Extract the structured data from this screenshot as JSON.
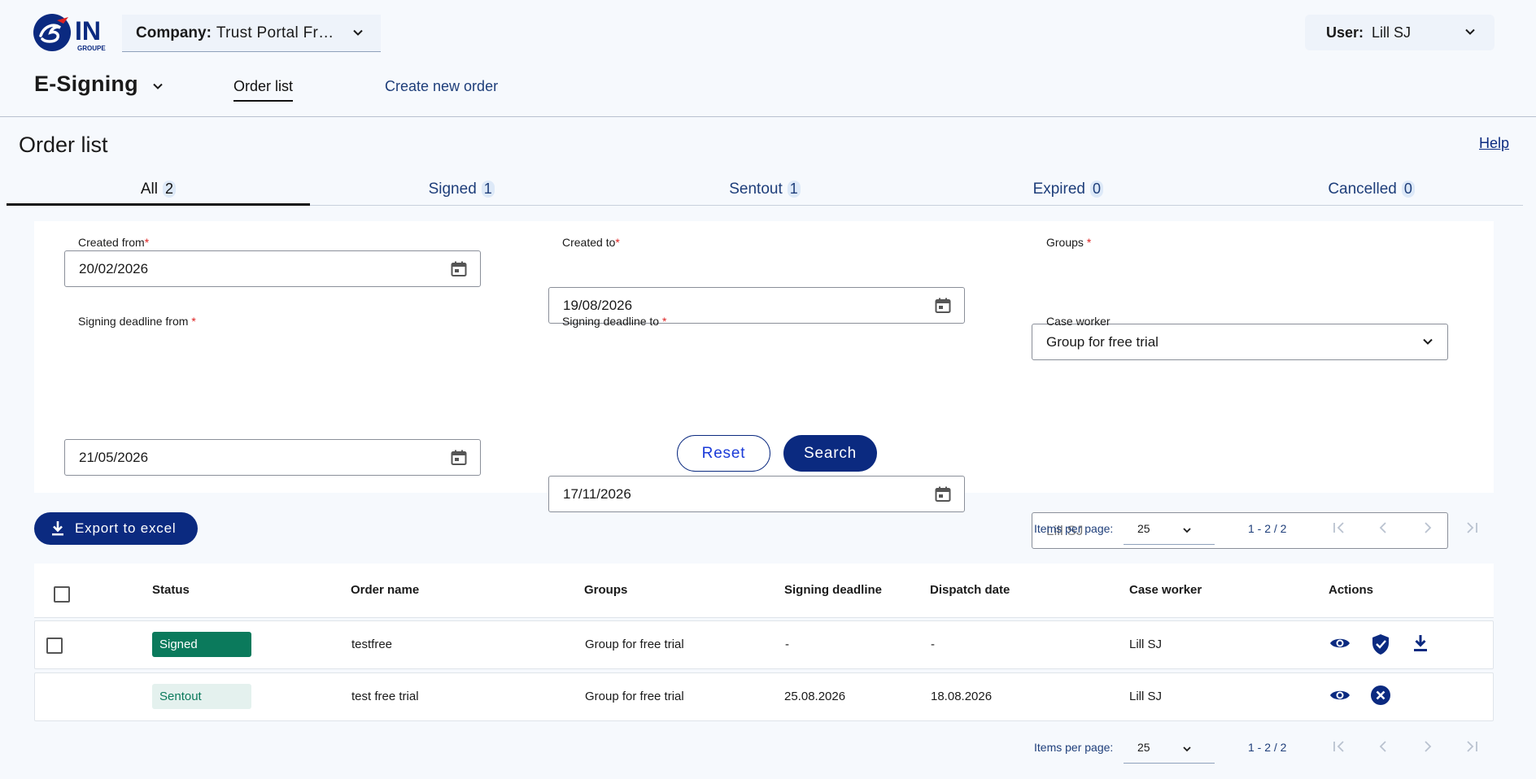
{
  "header": {
    "logo_text": "IN",
    "logo_subtext": "GROUPE",
    "company_label": "Company:",
    "company_value": "Trust Portal Fre...",
    "user_label": "User:",
    "user_value": "Lill SJ"
  },
  "app": {
    "name": "E-Signing",
    "nav_order_list": "Order list",
    "nav_create_order": "Create new order"
  },
  "page": {
    "title": "Order list",
    "help": "Help"
  },
  "tabs": [
    {
      "label": "All",
      "count": "2"
    },
    {
      "label": "Signed",
      "count": "1"
    },
    {
      "label": "Sentout",
      "count": "1"
    },
    {
      "label": "Expired",
      "count": "0"
    },
    {
      "label": "Cancelled",
      "count": "0"
    }
  ],
  "filters": {
    "created_from": {
      "label": "Created from",
      "value": "20/02/2026"
    },
    "created_to": {
      "label": "Created to",
      "value": "19/08/2026"
    },
    "groups": {
      "label": "Groups",
      "value": "Group for free trial"
    },
    "deadline_from": {
      "label": "Signing deadline from",
      "value": "21/05/2026"
    },
    "deadline_to": {
      "label": "Signing deadline to",
      "value": "17/11/2026"
    },
    "case_worker": {
      "label": "Case worker",
      "placeholder": "Lill SJ"
    },
    "required_mark": "*",
    "reset": "Reset",
    "search": "Search"
  },
  "toolbar": {
    "export": "Export to excel"
  },
  "pagination": {
    "items_per_page_label": "Items per page:",
    "items_per_page_value": "25",
    "range": "1 - 2 / 2"
  },
  "table": {
    "columns": [
      "Status",
      "Order name",
      "Groups",
      "Signing deadline",
      "Dispatch date",
      "Case worker",
      "Actions"
    ],
    "rows": [
      {
        "status": "Signed",
        "order_name": "testfree",
        "groups": "Group for free trial",
        "signing_deadline": "-",
        "dispatch_date": "-",
        "case_worker": "Lill SJ"
      },
      {
        "status": "Sentout",
        "order_name": "test free trial",
        "groups": "Group for free trial",
        "signing_deadline": "25.08.2026",
        "dispatch_date": "18.08.2026",
        "case_worker": "Lill SJ"
      }
    ]
  },
  "colors": {
    "primary": "#0b2a80",
    "signed": "#0b7a5c",
    "sentout_bg": "#e4f1ee",
    "background": "#f6f9fd"
  }
}
